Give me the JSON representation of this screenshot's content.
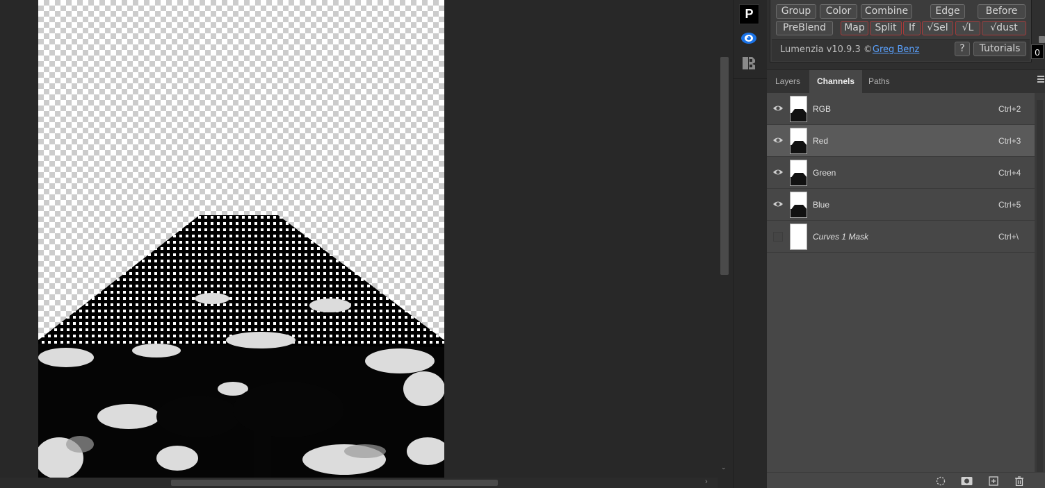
{
  "lumenzia": {
    "row1": [
      "Group",
      "Color",
      "Combine",
      "Edge",
      "Before"
    ],
    "row2": [
      "PreBlend",
      "Map",
      "Split",
      "If",
      "√Sel",
      "√L",
      "√dust"
    ],
    "version_text": "Lumenzia v10.9.3 ©",
    "author": "Greg Benz",
    "help_label": "?",
    "tutorials_label": "Tutorials"
  },
  "value_box": "0",
  "tabs": [
    "Layers",
    "Channels",
    "Paths"
  ],
  "active_tab": "Channels",
  "channels": [
    {
      "name": "RGB",
      "shortcut": "Ctrl+2",
      "visible": true,
      "selected": false
    },
    {
      "name": "Red",
      "shortcut": "Ctrl+3",
      "visible": true,
      "selected": true
    },
    {
      "name": "Green",
      "shortcut": "Ctrl+4",
      "visible": true,
      "selected": false
    },
    {
      "name": "Blue",
      "shortcut": "Ctrl+5",
      "visible": true,
      "selected": false
    },
    {
      "name": "Curves 1 Mask",
      "shortcut": "Ctrl+\\",
      "visible": false,
      "selected": false
    }
  ],
  "icons": {
    "plugin": "plugin-icon",
    "eye": "eye-icon",
    "panel": "panel-icon",
    "bottom": [
      "dotted-selection-icon",
      "save-selection-icon",
      "new-channel-icon",
      "delete-icon"
    ]
  },
  "colors": {
    "accent_link": "#5aa2ff",
    "eye_accent": "#1a73e8",
    "red_button_border": "#a93a3a"
  }
}
